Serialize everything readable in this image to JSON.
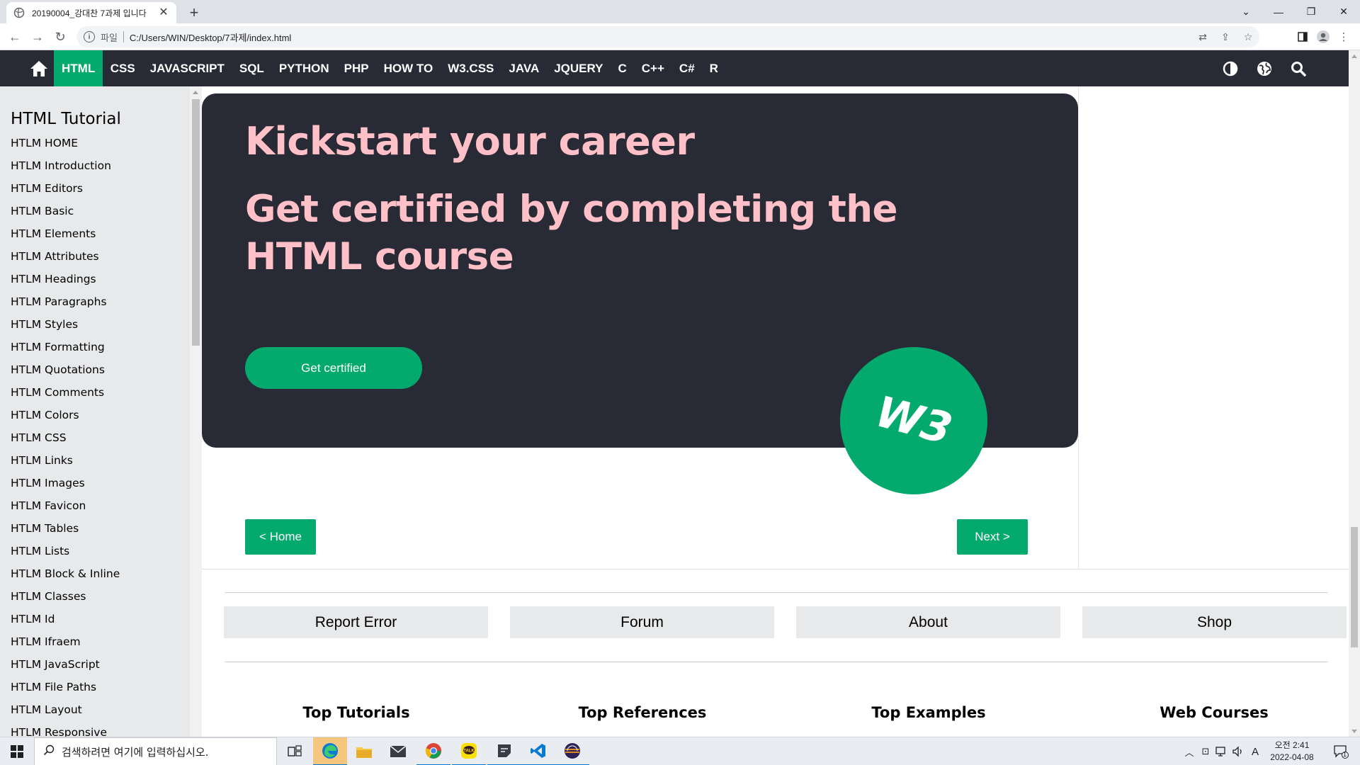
{
  "browser": {
    "tab_title": "20190004_강대찬 7과제 입니다",
    "new_tab": "+",
    "address_scheme": "파일",
    "address_url": "C:/Users/WIN/Desktop/7과제/index.html"
  },
  "topnav": {
    "items": [
      "HTML",
      "CSS",
      "JAVASCRIPT",
      "SQL",
      "PYTHON",
      "PHP",
      "HOW TO",
      "W3.CSS",
      "JAVA",
      "JQUERY",
      "C",
      "C++",
      "C#",
      "R"
    ]
  },
  "sidebar": {
    "title": "HTML Tutorial",
    "items": [
      "HTLM HOME",
      "HTLM Introduction",
      "HTLM Editors",
      "HTLM Basic",
      "HTLM Elements",
      "HTLM Attributes",
      "HTLM Headings",
      "HTLM Paragraphs",
      "HTLM Styles",
      "HTLM Formatting",
      "HTLM Quotations",
      "HTLM Comments",
      "HTLM Colors",
      "HTLM CSS",
      "HTLM Links",
      "HTLM Images",
      "HTLM Favicon",
      "HTLM Tables",
      "HTLM Lists",
      "HTLM Block & Inline",
      "HTLM Classes",
      "HTLM Id",
      "HTLM Ifraem",
      "HTLM JavaScript",
      "HTLM File Paths",
      "HTLM Layout",
      "HTLM Responsive"
    ]
  },
  "hero": {
    "title": "Kickstart your career",
    "subtitle": "Get certified by completing the HTML course",
    "button": "Get certified",
    "badge": "W3"
  },
  "pager": {
    "prev": "< Home",
    "next": "Next >"
  },
  "footer": {
    "buttons": [
      "Report Error",
      "Forum",
      "About",
      "Shop"
    ],
    "headings": [
      "Top Tutorials",
      "Top References",
      "Top Examples",
      "Web Courses"
    ]
  },
  "taskbar": {
    "search_placeholder": "검색하려면 여기에 입력하십시오.",
    "time": "오전 2:41",
    "date": "2022-04-08",
    "ime": "A",
    "notifications": "1"
  },
  "colors": {
    "nav_bg": "#282a35",
    "accent_green": "#04aa6d",
    "hero_text": "#ffc0c7",
    "sidebar_bg": "#e7e9eb"
  }
}
